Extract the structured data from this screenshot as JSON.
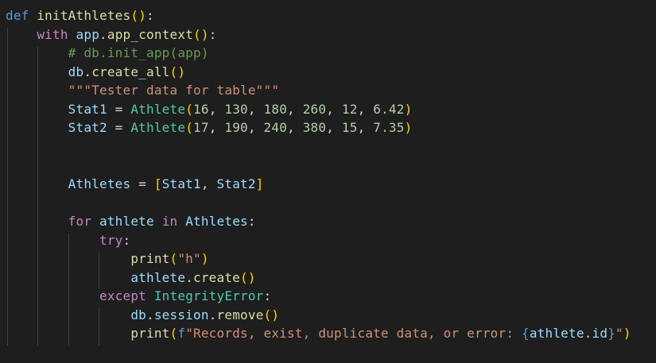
{
  "editor": {
    "language": "python",
    "theme": "Dark+",
    "colors": {
      "background": "#1e1e1e",
      "keyword": "#569cd6",
      "control_keyword": "#c586c0",
      "function": "#dcdcaa",
      "variable": "#9cdcfe",
      "class": "#4ec9b0",
      "number": "#b5cea8",
      "string": "#ce9178",
      "comment": "#6a9955",
      "bracket_level1": "#ffd700",
      "bracket_level2": "#da70d6",
      "bracket_level3": "#179fff"
    },
    "lines": [
      "def initAthletes():",
      "    with app.app_context():",
      "        # db.init_app(app)",
      "        db.create_all()",
      "        \"\"\"Tester data for table\"\"\"",
      "        Stat1 = Athlete(16, 130, 180, 260, 12, 6.42)",
      "        Stat2 = Athlete(17, 190, 240, 380, 15, 7.35)",
      "",
      "",
      "        Athletes = [Stat1, Stat2]",
      "",
      "        for athlete in Athletes:",
      "            try:",
      "                print(\"h\")",
      "                athlete.create()",
      "            except IntegrityError:",
      "                db.session.remove()",
      "                print(f\"Records, exist, duplicate data, or error: {athlete.id}\")"
    ],
    "tokens": {
      "l1": {
        "def": "def",
        "name": "initAthletes",
        "open": "(",
        "close": ")",
        "colon": ":"
      },
      "l2": {
        "with": "with",
        "obj": "app",
        "dot": ".",
        "fn": "app_context",
        "open": "(",
        "close": ")",
        "colon": ":"
      },
      "l3": {
        "comment": "# db.init_app(app)"
      },
      "l4": {
        "obj": "db",
        "dot": ".",
        "fn": "create_all",
        "open": "(",
        "close": ")"
      },
      "l5": {
        "docstring": "\"\"\"Tester data for table\"\"\""
      },
      "l6": {
        "var": "Stat1",
        "eq": " = ",
        "cls": "Athlete",
        "open": "(",
        "args": [
          "16",
          "130",
          "180",
          "260",
          "12",
          "6.42"
        ],
        "sep": ", ",
        "close": ")"
      },
      "l7": {
        "var": "Stat2",
        "eq": " = ",
        "cls": "Athlete",
        "open": "(",
        "args": [
          "17",
          "190",
          "240",
          "380",
          "15",
          "7.35"
        ],
        "sep": ", ",
        "close": ")"
      },
      "l10": {
        "var": "Athletes",
        "eq": " = ",
        "open": "[",
        "item1": "Stat1",
        "sep": ", ",
        "item2": "Stat2",
        "close": "]"
      },
      "l12": {
        "for": "for",
        "var": "athlete",
        "in": "in",
        "iter": "Athletes",
        "colon": ":"
      },
      "l13": {
        "try": "try",
        "colon": ":"
      },
      "l14": {
        "fn": "print",
        "open": "(",
        "str": "\"h\"",
        "close": ")"
      },
      "l15": {
        "obj": "athlete",
        "dot": ".",
        "fn": "create",
        "open": "(",
        "close": ")"
      },
      "l16": {
        "except": "except",
        "cls": "IntegrityError",
        "colon": ":"
      },
      "l17": {
        "obj": "db",
        "dot1": ".",
        "attr": "session",
        "dot2": ".",
        "fn": "remove",
        "open": "(",
        "close": ")"
      },
      "l18": {
        "fn": "print",
        "open": "(",
        "prefix": "f",
        "str_start": "\"Records, exist, duplicate data, or error: ",
        "brace_open": "{",
        "expr_obj": "athlete",
        "dot": ".",
        "expr_attr": "id",
        "brace_close": "}",
        "str_end": "\"",
        "close": ")"
      }
    }
  }
}
